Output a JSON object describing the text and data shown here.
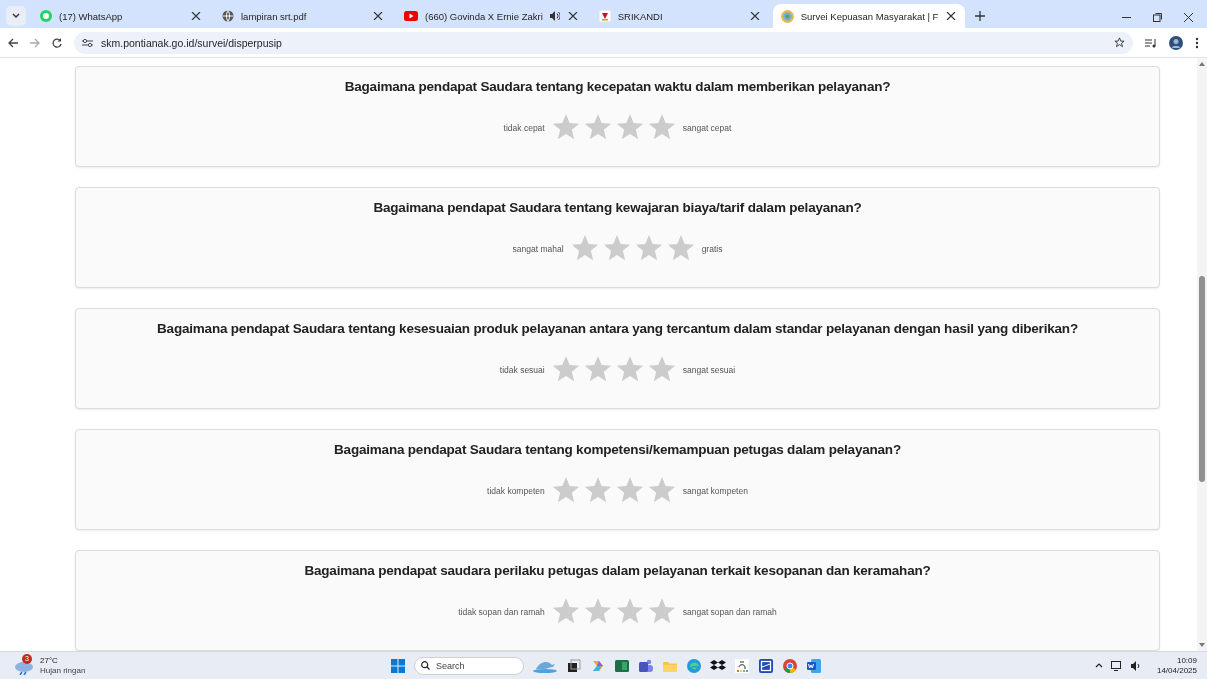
{
  "browser": {
    "tabs": [
      {
        "title": "(17) WhatsApp",
        "kind": "chat",
        "selected": false,
        "audio": false
      },
      {
        "title": "lampiran srt.pdf",
        "kind": "globe",
        "selected": false,
        "audio": false
      },
      {
        "title": "(660) Govinda X Ernie Zakri",
        "kind": "video",
        "selected": false,
        "audio": true
      },
      {
        "title": "SRIKANDI",
        "kind": "flag",
        "selected": false,
        "audio": false
      },
      {
        "title": "Survei Kepuasan Masyarakat | F",
        "kind": "seal",
        "selected": true,
        "audio": false
      }
    ],
    "url": "skm.pontianak.go.id/survei/disperpusip"
  },
  "questions": [
    {
      "question": "Bagaimana pendapat Saudara tentang kecepatan waktu dalam memberikan pelayanan?",
      "low": "tidak cepat",
      "high": "sangat cepat",
      "stars": 0
    },
    {
      "question": "Bagaimana pendapat Saudara tentang kewajaran biaya/tarif dalam pelayanan?",
      "low": "sangat mahal",
      "high": "gratis",
      "stars": 0
    },
    {
      "question": "Bagaimana pendapat Saudara tentang kesesuaian produk pelayanan antara yang tercantum dalam standar pelayanan dengan hasil yang diberikan?",
      "low": "tidak sesuai",
      "high": "sangat sesuai",
      "stars": 0
    },
    {
      "question": "Bagaimana pendapat Saudara tentang kompetensi/kemampuan petugas dalam pelayanan?",
      "low": "tidak kompeten",
      "high": "sangat kompeten",
      "stars": 0
    },
    {
      "question": "Bagaimana pendapat saudara perilaku petugas dalam  pelayanan terkait kesopanan dan keramahan?",
      "low": "tidak sopan dan ramah",
      "high": "sangat sopan dan ramah",
      "stars": 0
    }
  ],
  "taskbar": {
    "weather": {
      "badge": "3",
      "temperature": "27°C",
      "condition": "Hujan ringan"
    },
    "search": {
      "placeholder": "Search"
    },
    "time": "10:09",
    "date": "14/04/2025"
  }
}
